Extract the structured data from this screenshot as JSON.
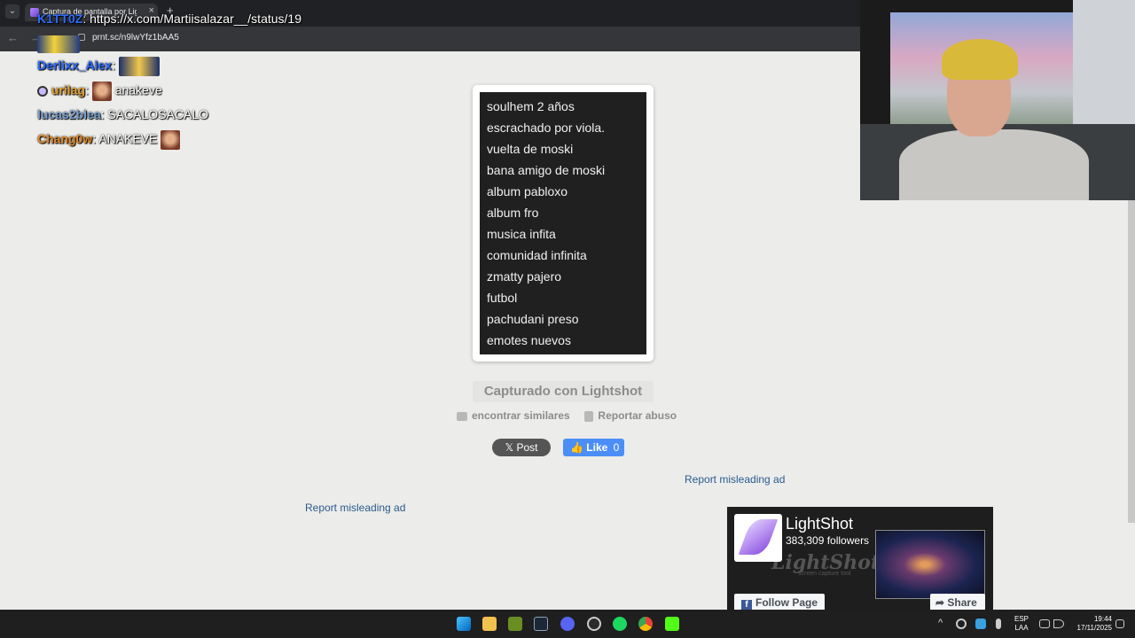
{
  "browser": {
    "tab_title": "Captura de pantalla por Lightshot",
    "url": "prnt.sc/n9lwYfz1bAA5",
    "tab_close": "×",
    "new_tab": "+",
    "back": "←",
    "forward": "→",
    "tab_menu": "⌄"
  },
  "chat": {
    "messages": [
      {
        "user": "K1TT0Z",
        "sep": ": ",
        "text": "https://x.com/Martiisalazar__/status/19",
        "user_color": "#2e6dff"
      },
      {
        "user": "Derlixx_Alex",
        "sep": ": ",
        "text": "",
        "user_color": "#2e6dff"
      },
      {
        "user": "urilag",
        "sep": ": ",
        "text": "anakeve",
        "user_color": "#e0a030"
      },
      {
        "user": "lucas2blea",
        "sep": ": ",
        "text": "SACALOSACALO",
        "user_color": "#7aa0d0"
      },
      {
        "user": "Chang0w",
        "sep": ": ",
        "text": "ANAKEVE",
        "user_color": "#e08a2a"
      }
    ]
  },
  "screenshot": {
    "items": [
      "soulhem 2 años",
      "escrachado por viola.",
      "vuelta de moski",
      "bana amigo de moski",
      "album pabloxo",
      "album fro",
      "musica infita",
      "comunidad infinita",
      "zmatty pajero",
      "futbol",
      "pachudani preso",
      "emotes nuevos"
    ]
  },
  "lightshot": {
    "captured_label": "Capturado con Lightshot",
    "find_similar": "encontrar similares",
    "report_abuse": "Reportar abuso",
    "post_label": "𝕏 Post",
    "like_label": "👍 Like",
    "like_count": "0",
    "report_ad_1": "Report misleading ad",
    "report_ad_2": "Report misleading ad"
  },
  "facebook_widget": {
    "page_name": "LightShot",
    "followers": "383,309 followers",
    "bg_logo": "LightShot",
    "bg_sub": "screen capture tool",
    "follow_label": "Follow Page",
    "follow_icon": "f",
    "share_label": "➦ Share"
  },
  "taskbar": {
    "lang_top": "ESP",
    "lang_bottom": "LAA",
    "time": "19:44",
    "date": "17/11/2025",
    "tray_up": "^",
    "icons": [
      "windows-icon",
      "file-explorer-icon",
      "app-icon",
      "steam-icon",
      "discord-icon",
      "obs-icon",
      "spotify-icon",
      "chrome-icon",
      "kick-icon"
    ]
  }
}
